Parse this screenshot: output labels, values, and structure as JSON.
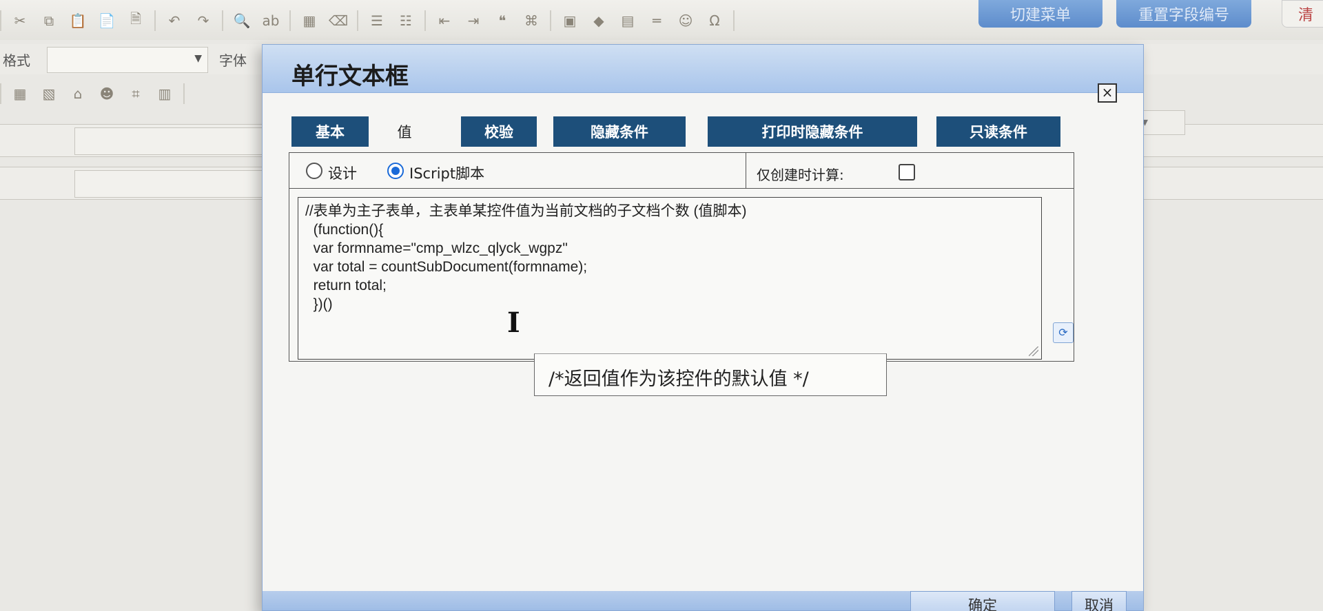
{
  "toolbar": {
    "format_label": "格式",
    "font_label": "字体",
    "top_buttons": [
      "切建菜单",
      "重置字段编号",
      "清"
    ]
  },
  "dialog": {
    "title": "单行文本框",
    "close": "×",
    "tabs": [
      {
        "label": "基本",
        "active": false
      },
      {
        "label": "值",
        "active": true
      },
      {
        "label": "校验",
        "active": false
      },
      {
        "label": "隐藏条件",
        "active": false
      },
      {
        "label": "打印时隐藏条件",
        "active": false
      },
      {
        "label": "只读条件",
        "active": false
      }
    ],
    "mode": {
      "design_label": "设计",
      "script_label": "IScript脚本",
      "selected": "IScript脚本"
    },
    "calc_on_create_label": "仅创建时计算:",
    "calc_on_create_checked": false,
    "code_lines": [
      "//表单为主子表单，主表单某控件值为当前文档的子文档个数 (值脚本)",
      "  (function(){",
      "  var formname=\"cmp_wlzc_qlyck_wgpz\"",
      "  var total = countSubDocument(formname);",
      "  return total;",
      "  })()"
    ],
    "tooltip": "/*返回值作为该控件的默认值 */",
    "footer": {
      "ok_label": "确定",
      "cancel_label": "取消"
    }
  },
  "colors": {
    "tab_bg": "#1d4f7a",
    "header_bg": "#a9c5eb",
    "radio_accent": "#1a6ad8"
  }
}
